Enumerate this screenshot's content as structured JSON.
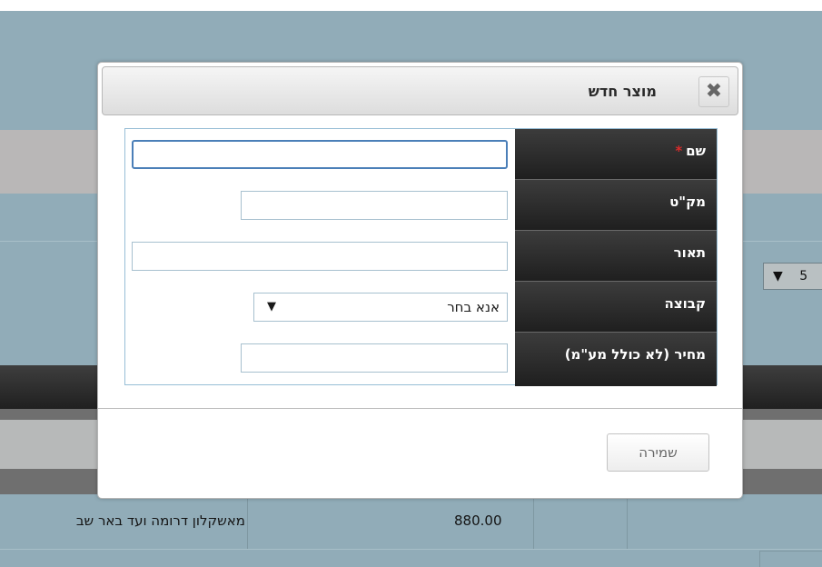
{
  "background": {
    "per_page_value": "5",
    "per_page_arrow": "▼",
    "row": {
      "location": "מאשקלון דרומה ועד באר שב",
      "price": "880.00"
    }
  },
  "dialog": {
    "title": "מוצר חדש",
    "close_icon": "close-icon",
    "fields": {
      "name": {
        "label": "שם",
        "required_mark": "*",
        "value": ""
      },
      "sku": {
        "label": "מק\"ט",
        "value": ""
      },
      "description": {
        "label": "תאור",
        "value": ""
      },
      "group": {
        "label": "קבוצה",
        "selected": "אנא בחר",
        "arrow": "▼"
      },
      "price": {
        "label": "מחיר (לא כולל מע\"מ)",
        "value": ""
      }
    },
    "save_label": "שמירה"
  },
  "colors": {
    "overlay_bg": "#91acb8",
    "label_bg": "#2e2e2e",
    "required": "#d92b2b",
    "input_border": "#a7c0cf",
    "focus_border": "#4b7fb8"
  }
}
